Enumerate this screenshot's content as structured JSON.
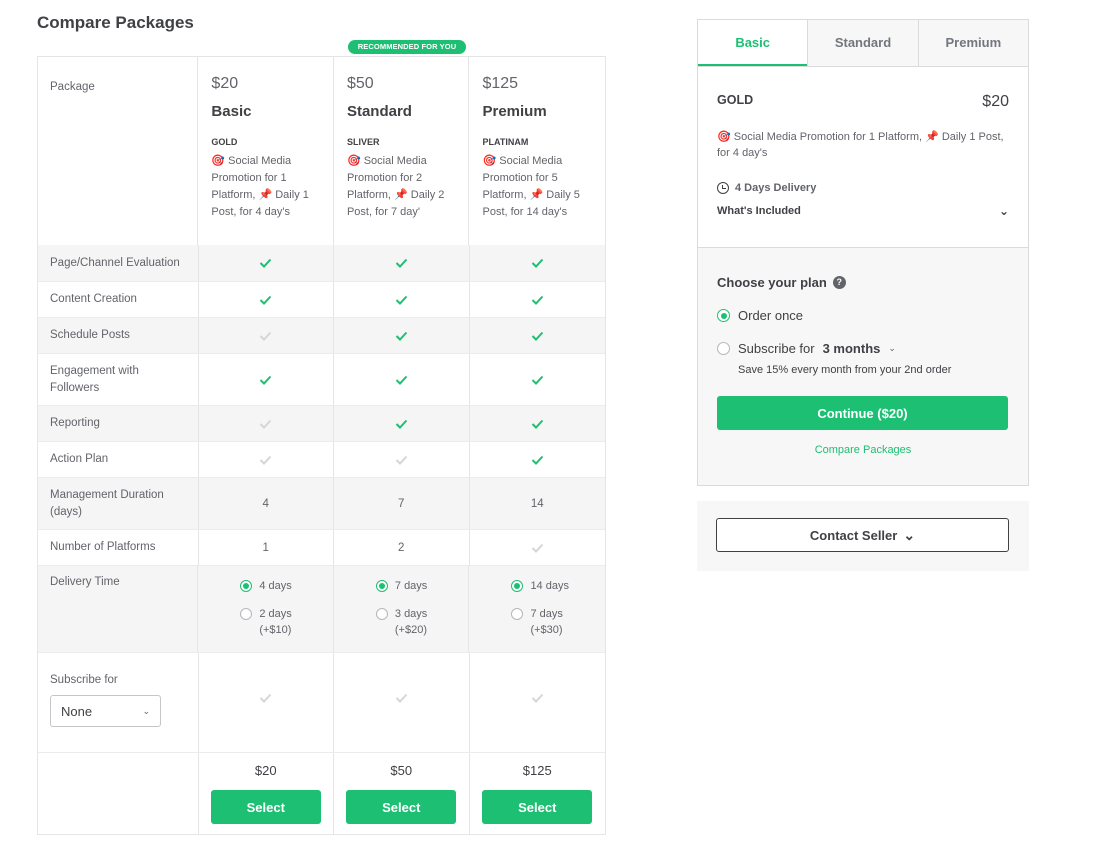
{
  "page_title": "Compare Packages",
  "recommended_badge": "RECOMMENDED FOR YOU",
  "table": {
    "package_label": "Package",
    "packages": [
      {
        "price": "$20",
        "name": "Basic",
        "tier": "GOLD",
        "desc": "🎯 Social Media Promotion for 1 Platform, 📌 Daily 1 Post, for 4 day's"
      },
      {
        "price": "$50",
        "name": "Standard",
        "tier": "SLIVER",
        "desc": "🎯 Social Media Promotion for 2 Platform, 📌 Daily 2 Post, for 7 day'"
      },
      {
        "price": "$125",
        "name": "Premium",
        "tier": "PLATINAM",
        "desc": "🎯 Social Media Promotion for 5 Platform, 📌 Daily 5 Post, for 14 day's"
      }
    ],
    "feature_rows": [
      {
        "label": "Page/Channel Evaluation",
        "values": [
          true,
          true,
          true
        ]
      },
      {
        "label": "Content Creation",
        "values": [
          true,
          true,
          true
        ]
      },
      {
        "label": "Schedule Posts",
        "values": [
          false,
          true,
          true
        ]
      },
      {
        "label": "Engagement with Followers",
        "values": [
          true,
          true,
          true
        ]
      },
      {
        "label": "Reporting",
        "values": [
          false,
          true,
          true
        ]
      },
      {
        "label": "Action Plan",
        "values": [
          false,
          false,
          true
        ]
      }
    ],
    "duration_label": "Management Duration (days)",
    "durations": [
      "4",
      "7",
      "14"
    ],
    "platforms_label": "Number of Platforms",
    "platforms": [
      "1",
      "2"
    ],
    "delivery_label": "Delivery Time",
    "delivery": [
      {
        "standard": "4 days",
        "fast": "2 days",
        "fast_price": "(+$10)"
      },
      {
        "standard": "7 days",
        "fast": "3 days",
        "fast_price": "(+$20)"
      },
      {
        "standard": "14 days",
        "fast": "7 days",
        "fast_price": "(+$30)"
      }
    ],
    "subscribe_label": "Subscribe for",
    "subscribe_value": "None",
    "bottom_prices": [
      "$20",
      "$50",
      "$125"
    ],
    "select_label": "Select"
  },
  "card": {
    "tabs": [
      "Basic",
      "Standard",
      "Premium"
    ],
    "active_tab": 0,
    "tier": "GOLD",
    "price": "$20",
    "desc": "🎯 Social Media Promotion for 1 Platform, 📌 Daily 1 Post, for 4 day's",
    "delivery": "4 Days Delivery",
    "included": "What's Included",
    "plan_title": "Choose your plan",
    "help_icon_text": "?",
    "order_once": "Order once",
    "subscribe_prefix": "Subscribe for",
    "subscribe_period": "3 months",
    "save_note": "Save 15% every month from your 2nd order",
    "continue_label": "Continue ($20)",
    "compare_link": "Compare Packages"
  },
  "contact_label": "Contact Seller",
  "colors": {
    "accent": "#1dbf73",
    "text": "#404145",
    "muted": "#62646a",
    "border": "#e4e5e7"
  }
}
